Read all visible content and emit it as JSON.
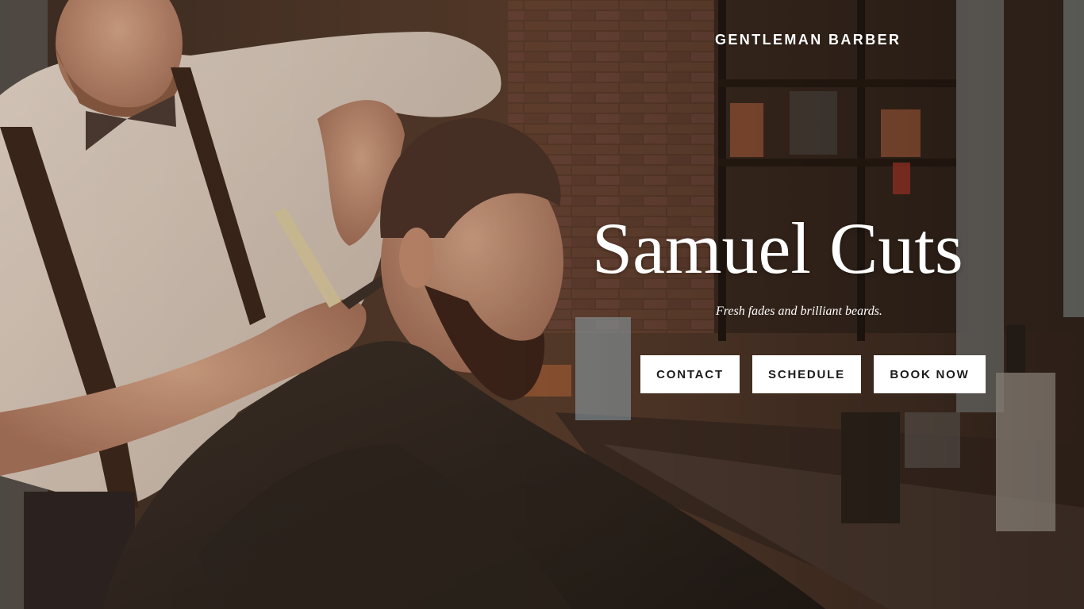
{
  "site": {
    "brand": "GENTLEMAN BARBER",
    "title": "Samuel Cuts",
    "tagline": "Fresh fades and brilliant beards."
  },
  "buttons": {
    "contact": "CONTACT",
    "schedule": "SCHEDULE",
    "book_now": "BOOK NOW"
  },
  "colors": {
    "text": "#ffffff",
    "button_bg": "#ffffff",
    "button_text": "#1b1b1b"
  }
}
